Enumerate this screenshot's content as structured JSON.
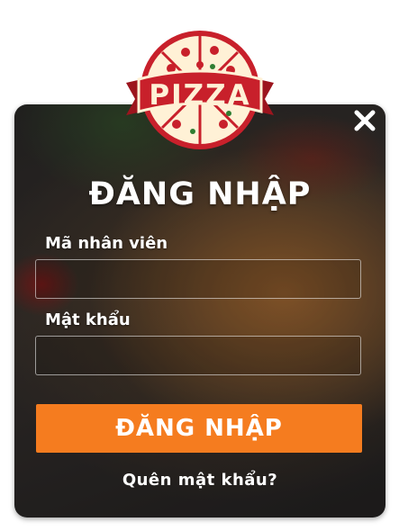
{
  "logo": {
    "text": "PIZZA",
    "brand_color": "#c8202b",
    "cream_color": "#fff1d6"
  },
  "close_icon": "close-icon",
  "login": {
    "title": "ĐĂNG NHẬP",
    "employee_id_label": "Mã nhân viên",
    "employee_id_value": "",
    "password_label": "Mật khẩu",
    "password_value": "",
    "submit_label": "ĐĂNG NHẬP",
    "forgot_password": "Quên mật khẩu?"
  },
  "colors": {
    "accent": "#f57c1f",
    "text": "#ffffff"
  }
}
